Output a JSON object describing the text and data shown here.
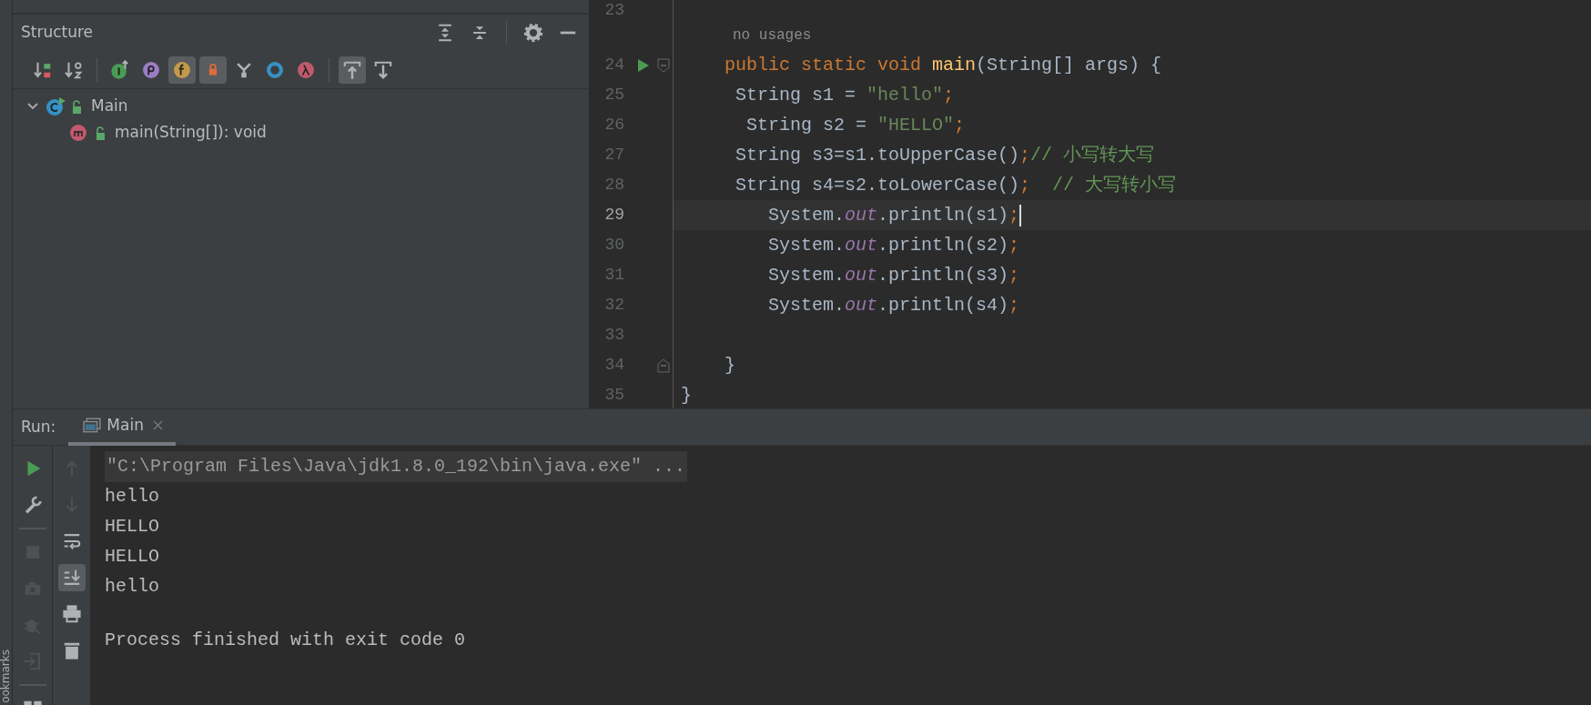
{
  "side_strip": {
    "label": "ookmarks"
  },
  "structure_panel": {
    "title": "Structure",
    "header_tools": [
      {
        "kind": "expand-all"
      },
      {
        "kind": "collapse-all"
      },
      {
        "kind": "separator"
      },
      {
        "kind": "settings"
      },
      {
        "kind": "minimize"
      }
    ],
    "toolbar": [
      {
        "kind": "sort-visibility",
        "selected": false
      },
      {
        "kind": "sort-alpha",
        "selected": false
      },
      {
        "kind": "separator"
      },
      {
        "kind": "inherited",
        "selected": false
      },
      {
        "kind": "properties",
        "selected": false
      },
      {
        "kind": "fields",
        "selected": true
      },
      {
        "kind": "non-public",
        "selected": true
      },
      {
        "kind": "fork",
        "selected": false
      },
      {
        "kind": "anonymous",
        "selected": false
      },
      {
        "kind": "lambda",
        "selected": false
      },
      {
        "kind": "separator"
      },
      {
        "kind": "scroll-to-source",
        "selected": true
      },
      {
        "kind": "scroll-from-source",
        "selected": false
      }
    ],
    "tree": [
      {
        "label": "Main",
        "kind": "class",
        "expanded": true,
        "children": [
          {
            "label": "main(String[]): void",
            "kind": "method"
          }
        ]
      }
    ]
  },
  "editor": {
    "lines": [
      {
        "number": "23",
        "current": false
      },
      {
        "number": "24",
        "current": false,
        "hint": "no usages",
        "run_marker": true,
        "fold_start": true,
        "tokens": [
          {
            "kind": "keyword",
            "text": "    public static void "
          },
          {
            "kind": "method",
            "text": "main"
          },
          {
            "kind": "plain",
            "text": "(String[] args) {"
          }
        ]
      },
      {
        "number": "25",
        "current": false,
        "tokens": [
          {
            "kind": "plain",
            "text": "     String s1 = "
          },
          {
            "kind": "string",
            "text": "\"hello\""
          },
          {
            "kind": "keyword",
            "text": ";"
          }
        ]
      },
      {
        "number": "26",
        "current": false,
        "tokens": [
          {
            "kind": "plain",
            "text": "      String s2 = "
          },
          {
            "kind": "string",
            "text": "\"HELLO\""
          },
          {
            "kind": "keyword",
            "text": ";"
          }
        ]
      },
      {
        "number": "27",
        "current": false,
        "tokens": [
          {
            "kind": "plain",
            "text": "     String s3=s1.toUpperCase()"
          },
          {
            "kind": "keyword",
            "text": ";"
          },
          {
            "kind": "comment",
            "text": "// 小写转大写"
          }
        ]
      },
      {
        "number": "28",
        "current": false,
        "tokens": [
          {
            "kind": "plain",
            "text": "     String s4=s2.toLowerCase()"
          },
          {
            "kind": "keyword",
            "text": ";"
          },
          {
            "kind": "comment",
            "text": "  // 大写转小写"
          }
        ]
      },
      {
        "number": "29",
        "current": true,
        "tokens": [
          {
            "kind": "plain",
            "text": "        System."
          },
          {
            "kind": "field",
            "text": "out"
          },
          {
            "kind": "plain",
            "text": ".println(s1)"
          },
          {
            "kind": "keyword",
            "text": ";"
          }
        ]
      },
      {
        "number": "30",
        "current": false,
        "tokens": [
          {
            "kind": "plain",
            "text": "        System."
          },
          {
            "kind": "field",
            "text": "out"
          },
          {
            "kind": "plain",
            "text": ".println(s2)"
          },
          {
            "kind": "keyword",
            "text": ";"
          }
        ]
      },
      {
        "number": "31",
        "current": false,
        "tokens": [
          {
            "kind": "plain",
            "text": "        System."
          },
          {
            "kind": "field",
            "text": "out"
          },
          {
            "kind": "plain",
            "text": ".println(s3)"
          },
          {
            "kind": "keyword",
            "text": ";"
          }
        ]
      },
      {
        "number": "32",
        "current": false,
        "tokens": [
          {
            "kind": "plain",
            "text": "        System."
          },
          {
            "kind": "field",
            "text": "out"
          },
          {
            "kind": "plain",
            "text": ".println(s4)"
          },
          {
            "kind": "keyword",
            "text": ";"
          }
        ]
      },
      {
        "number": "33",
        "current": false
      },
      {
        "number": "34",
        "current": false,
        "fold_end": true,
        "tokens": [
          {
            "kind": "plain",
            "text": "    }"
          }
        ]
      },
      {
        "number": "35",
        "current": false,
        "tokens": [
          {
            "kind": "plain",
            "text": "}"
          }
        ]
      }
    ]
  },
  "run_panel": {
    "title": "Run:",
    "tabs": [
      {
        "label": "Main",
        "selected": true
      }
    ],
    "left_tools": [
      {
        "kind": "run",
        "disabled": false
      },
      {
        "kind": "wrench",
        "disabled": false
      },
      {
        "kind": "separator"
      },
      {
        "kind": "stop",
        "disabled": true
      },
      {
        "kind": "camera",
        "disabled": true
      },
      {
        "kind": "bug",
        "disabled": true
      },
      {
        "kind": "exit",
        "disabled": true
      },
      {
        "kind": "separator"
      },
      {
        "kind": "layout",
        "disabled": false
      }
    ],
    "right_tools": [
      {
        "kind": "up",
        "disabled": true,
        "selected": false
      },
      {
        "kind": "down",
        "disabled": true,
        "selected": false
      },
      {
        "kind": "wrap",
        "disabled": false,
        "selected": false
      },
      {
        "kind": "scroll-end",
        "disabled": false,
        "selected": true
      },
      {
        "kind": "print",
        "disabled": false,
        "selected": false
      },
      {
        "kind": "trash",
        "disabled": false,
        "selected": false
      }
    ],
    "console": [
      {
        "kind": "command",
        "text": "\"C:\\Program Files\\Java\\jdk1.8.0_192\\bin\\java.exe\" ..."
      },
      {
        "kind": "output",
        "text": "hello"
      },
      {
        "kind": "output",
        "text": "HELLO"
      },
      {
        "kind": "output",
        "text": "HELLO"
      },
      {
        "kind": "output",
        "text": "hello"
      },
      {
        "kind": "status",
        "text": "Process finished with exit code 0"
      }
    ]
  }
}
